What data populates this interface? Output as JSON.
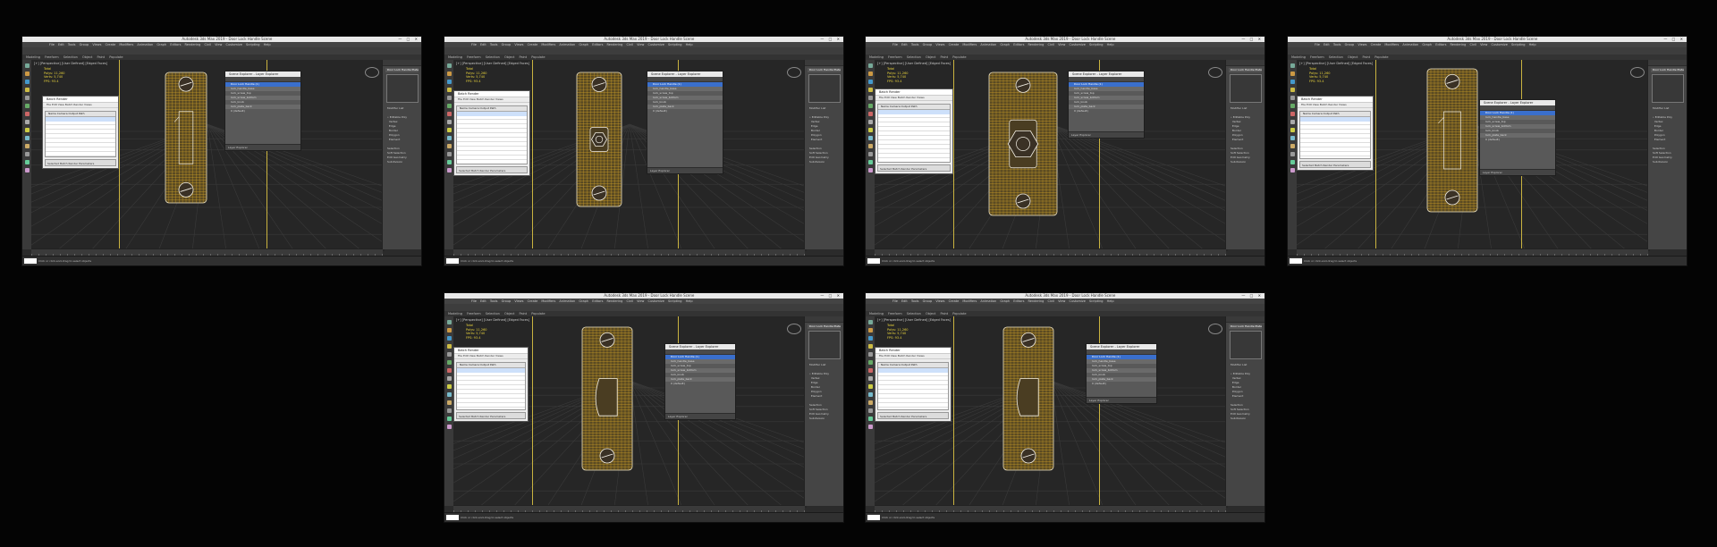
{
  "app": {
    "title_bar": "Autodesk 3ds Max 2019 - Door Lock Handle Scene",
    "window_buttons": "— □ ✕",
    "menu_items": [
      "File",
      "Edit",
      "Tools",
      "Group",
      "Views",
      "Create",
      "Modifiers",
      "Animation",
      "Graph Editors",
      "Rendering",
      "Civil View",
      "Customize",
      "Scripting",
      "Help"
    ],
    "ribbon_tabs": [
      "Modeling",
      "Freeform",
      "Selection",
      "Object Paint",
      "Populate"
    ],
    "viewport_label": "[+] [Perspective] [User Defined] [Edged Faces]",
    "stats": "Total\nPolys: 11,260\nVerts: 5,740\nFPS: 93.4",
    "status_message": "Click or click-and-drag to select objects",
    "status_controls": [
      "key",
      "filter",
      "play",
      "stop"
    ],
    "colors": {
      "background": "#040404",
      "viewport": "#262626",
      "wire": "#d7a628",
      "safe_frame": "#c9b340",
      "selection": "#3a6fcc"
    }
  },
  "scene_explorer": {
    "title": "Scene Explorer - Layer Explorer",
    "items": [
      "Door Lock Handle (1)",
      "lock_handle_base",
      "lock_screw_top",
      "lock_screw_bottom",
      "lock_knob",
      "lock_plate_back",
      "0 (default)"
    ],
    "footer": "Layer Explorer"
  },
  "batch_render": {
    "title": "Batch Render",
    "menu": "File  Edit  View  Batch Render Views",
    "column_header": "Name                    Camera    Output Path",
    "bottom": "Selected Batch Render Parameters"
  },
  "command_panel": {
    "object_name": "Door Lock Handle Plate",
    "lines": "Modifier List\n\n• Editable Poly\n  Vertex\n  Edge\n  Border\n  Polygon\n  Element\n\nSelection\nSoft Selection\nEdit Geometry\nSubdivision"
  },
  "shots": [
    {
      "id": "s1",
      "model": "flat"
    },
    {
      "id": "s2",
      "model": "screw"
    },
    {
      "id": "s3",
      "model": "screw_close"
    },
    {
      "id": "s4",
      "model": "flat"
    },
    {
      "id": "s5",
      "model": "knob"
    },
    {
      "id": "s6",
      "model": "knob"
    }
  ]
}
